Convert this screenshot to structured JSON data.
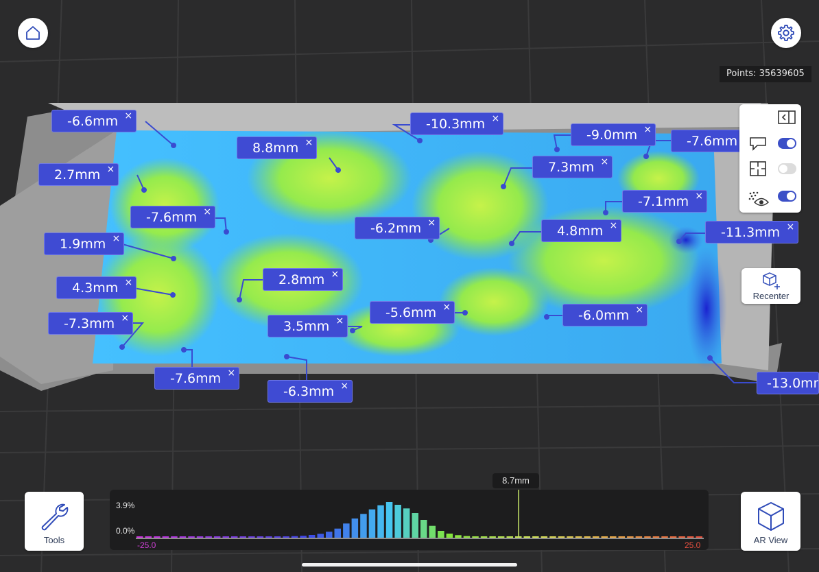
{
  "points_readout": "Points: 35639605",
  "top_buttons": {
    "home_icon": "home-icon",
    "settings_icon": "gear-icon"
  },
  "colors": {
    "background": "#2b2b2c",
    "tag_fill": "#3f4bd3",
    "toggle_on": "#3b4fc7",
    "toggle_off": "#dcdcdc",
    "icon_stroke": "#2f4bb8"
  },
  "measurements": [
    {
      "label": "-6.6mm"
    },
    {
      "label": "8.8mm"
    },
    {
      "label": "-10.3mm"
    },
    {
      "label": "-9.0mm"
    },
    {
      "label": "-7.6mm"
    },
    {
      "label": "2.7mm"
    },
    {
      "label": "7.3mm"
    },
    {
      "label": "-7.6mm"
    },
    {
      "label": "-7.1mm"
    },
    {
      "label": "-6.2mm"
    },
    {
      "label": "4.8mm"
    },
    {
      "label": "-11.3mm"
    },
    {
      "label": "1.9mm"
    },
    {
      "label": "2.8mm"
    },
    {
      "label": "4.3mm"
    },
    {
      "label": "-5.6mm"
    },
    {
      "label": "-6.0mm"
    },
    {
      "label": "-7.3mm"
    },
    {
      "label": "3.5mm"
    },
    {
      "label": "-7.6mm"
    },
    {
      "label": "-6.3mm"
    },
    {
      "label": "-13.0mm"
    }
  ],
  "remove_glyph": "×",
  "side_panel": {
    "collapse_icon": "collapse-panel-icon",
    "rows": [
      {
        "icon": "comment-icon",
        "state": "on"
      },
      {
        "icon": "floorplan-icon",
        "state": "off"
      },
      {
        "icon": "point-cloud-eye-icon",
        "state": "on"
      }
    ]
  },
  "recenter": {
    "label": "Recenter",
    "icon": "recenter-cube-icon"
  },
  "tools": {
    "label": "Tools",
    "icon": "wrench-icon"
  },
  "ar_view": {
    "label": "AR View",
    "icon": "cube-icon"
  },
  "histogram": {
    "marker_value": "8.7mm",
    "y_max_label": "3.9%",
    "y_min_label": "0.0%",
    "x_min_label": "-25.0",
    "x_max_label": "25.0"
  },
  "chart_data": {
    "type": "bar",
    "title": "",
    "xlabel": "",
    "ylabel": "",
    "xlim": [
      -25.0,
      25.0
    ],
    "ylim": [
      0.0,
      3.9
    ],
    "marker": 8.7,
    "values": [
      0.05,
      0.05,
      0.05,
      0.05,
      0.05,
      0.05,
      0.05,
      0.05,
      0.05,
      0.05,
      0.05,
      0.05,
      0.05,
      0.05,
      0.06,
      0.08,
      0.1,
      0.13,
      0.17,
      0.22,
      0.3,
      0.43,
      0.65,
      1.0,
      1.55,
      2.1,
      2.6,
      3.1,
      3.55,
      3.9,
      3.6,
      3.2,
      2.7,
      1.95,
      1.3,
      0.75,
      0.45,
      0.28,
      0.18,
      0.13,
      0.1,
      0.08,
      0.07,
      0.07,
      0.06,
      0.06,
      0.06,
      0.06,
      0.06,
      0.06,
      0.06,
      0.06,
      0.06,
      0.06,
      0.06,
      0.06,
      0.06,
      0.06,
      0.06,
      0.06,
      0.06,
      0.06,
      0.06,
      0.06,
      0.06,
      0.06
    ]
  }
}
